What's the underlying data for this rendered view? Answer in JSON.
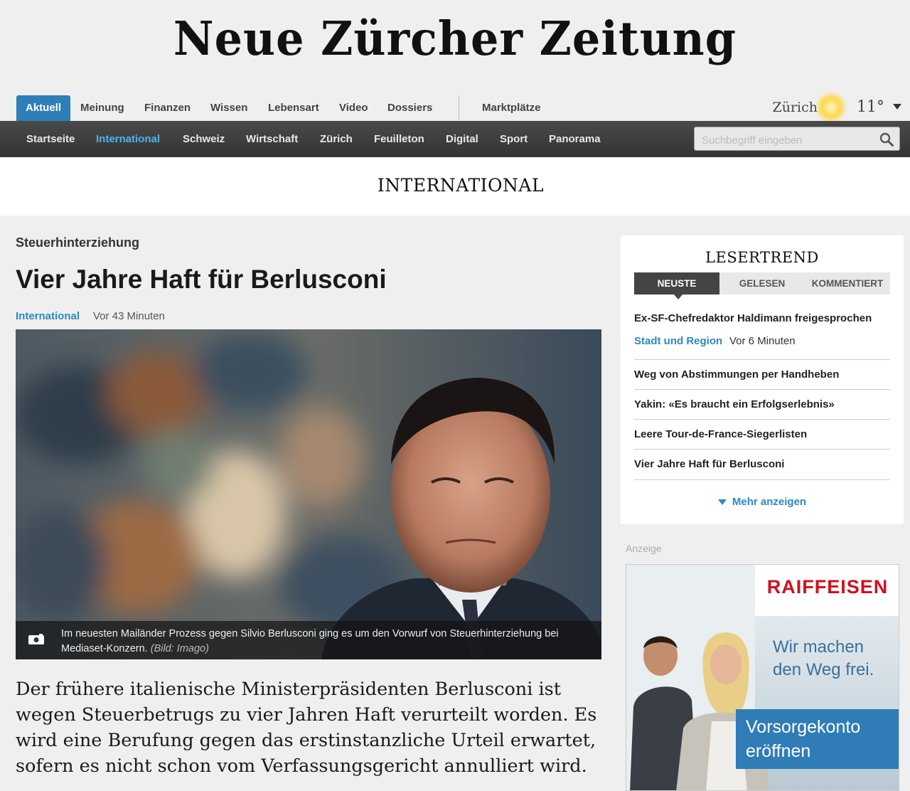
{
  "site": {
    "logo": "Neue Zürcher Zeitung"
  },
  "top_nav": {
    "tabs": [
      "Aktuell",
      "Meinung",
      "Finanzen",
      "Wissen",
      "Lebensart",
      "Video",
      "Dossiers"
    ],
    "active_tab": "Aktuell",
    "extra": "Marktplätze"
  },
  "weather": {
    "city": "Zürich",
    "temperature": "11°",
    "icon": "sun-icon"
  },
  "sub_nav": {
    "items": [
      "Startseite",
      "International",
      "Schweiz",
      "Wirtschaft",
      "Zürich",
      "Feuilleton",
      "Digital",
      "Sport",
      "Panorama"
    ],
    "active_item": "International"
  },
  "search": {
    "placeholder": "Suchbegriff eingeben",
    "value": ""
  },
  "section_title": "INTERNATIONAL",
  "article": {
    "kicker": "Steuerhinterziehung",
    "headline": "Vier Jahre Haft für Berlusconi",
    "category": "International",
    "time": "Vor 43 Minuten",
    "caption": "Im neuesten Mailänder Prozess gegen Silvio Berlusconi ging es um den Vorwurf von Steuerhinterziehung bei Mediaset-Konzern.",
    "caption_credit": "(Bild: Imago)",
    "lead": "Der frühere italienische Ministerpräsidenten Berlusconi ist wegen Steuerbetrugs zu vier Jahren Haft verurteilt worden. Es wird eine Berufung gegen das erstinstanzliche Urteil erwartet, sofern es nicht schon vom Verfassungsgericht annulliert wird."
  },
  "lesertrend": {
    "title": "LESERTREND",
    "tabs": [
      "NEUSTE",
      "GELESEN",
      "KOMMENTIERT"
    ],
    "active_tab": "NEUSTE",
    "first_item": {
      "title": "Ex-SF-Chefredaktor Haldimann freigesprochen",
      "category": "Stadt und Region",
      "time": "Vor 6 Minuten"
    },
    "items": [
      "Weg von Abstimmungen per Handheben",
      "Yakin: «Es braucht ein Erfolgserlebnis»",
      "Leere Tour-de-France-Siegerlisten",
      "Vier Jahre Haft für Berlusconi"
    ],
    "more": "Mehr anzeigen"
  },
  "ad": {
    "label": "Anzeige",
    "brand": "RAIFFEISEN",
    "slogan": "Wir machen den Weg frei.",
    "cta": "Vorsorgekonto eröffnen",
    "brand_color": "#d1101f"
  },
  "colors": {
    "accent": "#2e7fb8",
    "link": "#2e88c4",
    "subnav_active": "#4fb3ef"
  }
}
